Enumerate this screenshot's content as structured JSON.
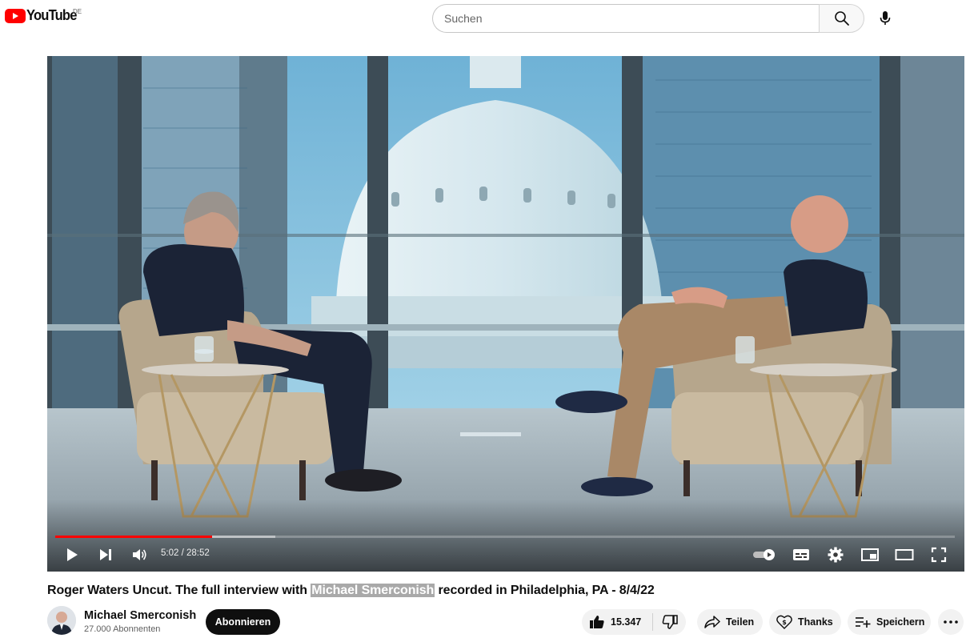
{
  "header": {
    "logo_text": "YouTube",
    "country_code": "DE",
    "search_placeholder": "Suchen",
    "search_icon": "search-icon",
    "mic_icon": "microphone-icon"
  },
  "player": {
    "time_display": "5:02 / 28:52",
    "progress_fraction": 0.1744,
    "buffered_fraction": 0.245,
    "icons": [
      "play-icon",
      "next-icon",
      "volume-icon",
      "autoplay-toggle-icon",
      "subtitles-icon",
      "settings-icon",
      "miniplayer-icon",
      "theater-mode-icon",
      "fullscreen-icon"
    ]
  },
  "video": {
    "title_before": "Roger Waters Uncut. The full interview with ",
    "title_highlight": "Michael Smerconish",
    "title_after": " recorded in Philadelphia, PA - 8/4/22"
  },
  "channel": {
    "name": "Michael Smerconish",
    "subscribers": "27.000 Abonnenten",
    "subscribe_label": "Abonnieren"
  },
  "actions": {
    "like_count": "15.347",
    "share_label": "Teilen",
    "thanks_label": "Thanks",
    "save_label": "Speichern"
  },
  "colors": {
    "brand_red": "#ff0000",
    "text_primary": "#0f0f0f",
    "text_secondary": "#606060",
    "pill_bg": "#f2f2f2",
    "highlight_bg": "#a9a9a9"
  }
}
